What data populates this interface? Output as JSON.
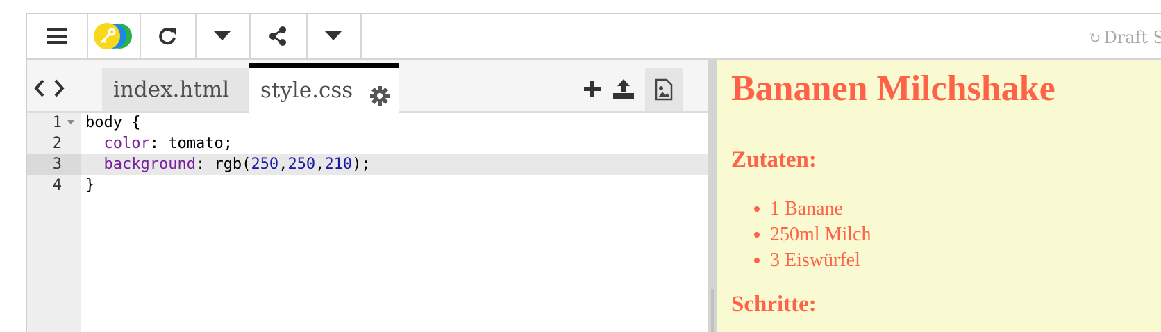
{
  "toolbar": {
    "draft_status": "Draft S",
    "buttons": [
      "menu",
      "logo",
      "refresh",
      "dropdown",
      "share",
      "share-dropdown"
    ]
  },
  "tabs": [
    {
      "label": "index.html",
      "active": false
    },
    {
      "label": "style.css",
      "active": true
    }
  ],
  "editor": {
    "line_numbers": [
      "1",
      "2",
      "3",
      "4"
    ],
    "active_line": 3,
    "code": {
      "line1": "body {",
      "line2_prop": "color",
      "line2_rest": ": tomato;",
      "line3_prop": "background",
      "line3_fn": ": rgb(",
      "line3_n1": "250",
      "line3_n2": "250",
      "line3_n3": "210",
      "line3_end": ");",
      "line4": "}"
    }
  },
  "preview": {
    "title": "Bananen Milchshake",
    "ingredients_heading": "Zutaten:",
    "ingredients": [
      "1 Banane",
      "250ml Milch",
      "3 Eiswürfel"
    ],
    "steps_heading": "Schritte:",
    "text_color": "tomato",
    "background": "rgb(250,250,210)"
  },
  "icons": [
    "hamburger-icon",
    "key-logo-icon",
    "refresh-icon",
    "chevron-down-icon",
    "share-icon",
    "arrow-left-icon",
    "arrow-right-icon",
    "gear-icon",
    "plus-icon",
    "upload-icon",
    "image-file-icon"
  ]
}
